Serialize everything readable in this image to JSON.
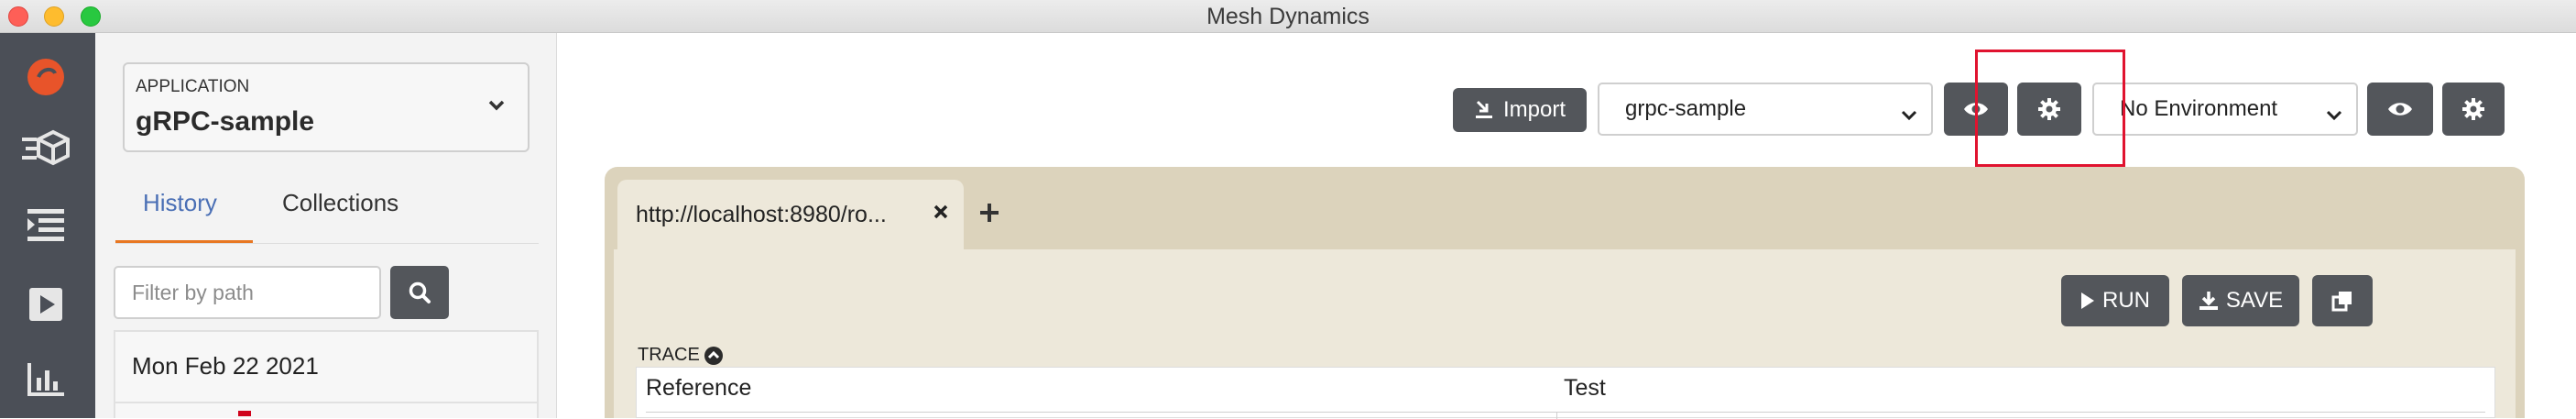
{
  "window": {
    "title": "Mesh Dynamics"
  },
  "iconbar": {
    "items": [
      {
        "name": "logo-icon"
      },
      {
        "name": "cube-list-icon"
      },
      {
        "name": "indent-list-icon"
      },
      {
        "name": "play-icon"
      },
      {
        "name": "bar-chart-icon"
      }
    ]
  },
  "sidebar": {
    "application": {
      "caption": "APPLICATION",
      "value": "gRPC-sample"
    },
    "tabs": [
      {
        "label": "History",
        "active": true
      },
      {
        "label": "Collections",
        "active": false
      }
    ],
    "filter": {
      "placeholder": "Filter by path",
      "value": ""
    },
    "history": {
      "date": "Mon Feb 22 2021"
    }
  },
  "toolbar": {
    "import_label": "Import",
    "service_select": "grpc-sample",
    "environment_select": "No Environment"
  },
  "request_tab": {
    "label": "http://localhost:8980/ro...",
    "close_symbol": "✕"
  },
  "actions": {
    "run_label": "RUN",
    "save_label": "SAVE"
  },
  "trace": {
    "label": "TRACE",
    "columns": [
      "Reference",
      "Test"
    ]
  },
  "colors": {
    "iconbar_bg": "#4b4f57",
    "dark_button": "#53565b",
    "accent_orange": "#e87722",
    "history_blue": "#4a6fb5",
    "workspace_tan": "#dcd3bc",
    "highlight_red": "#e0132f"
  }
}
